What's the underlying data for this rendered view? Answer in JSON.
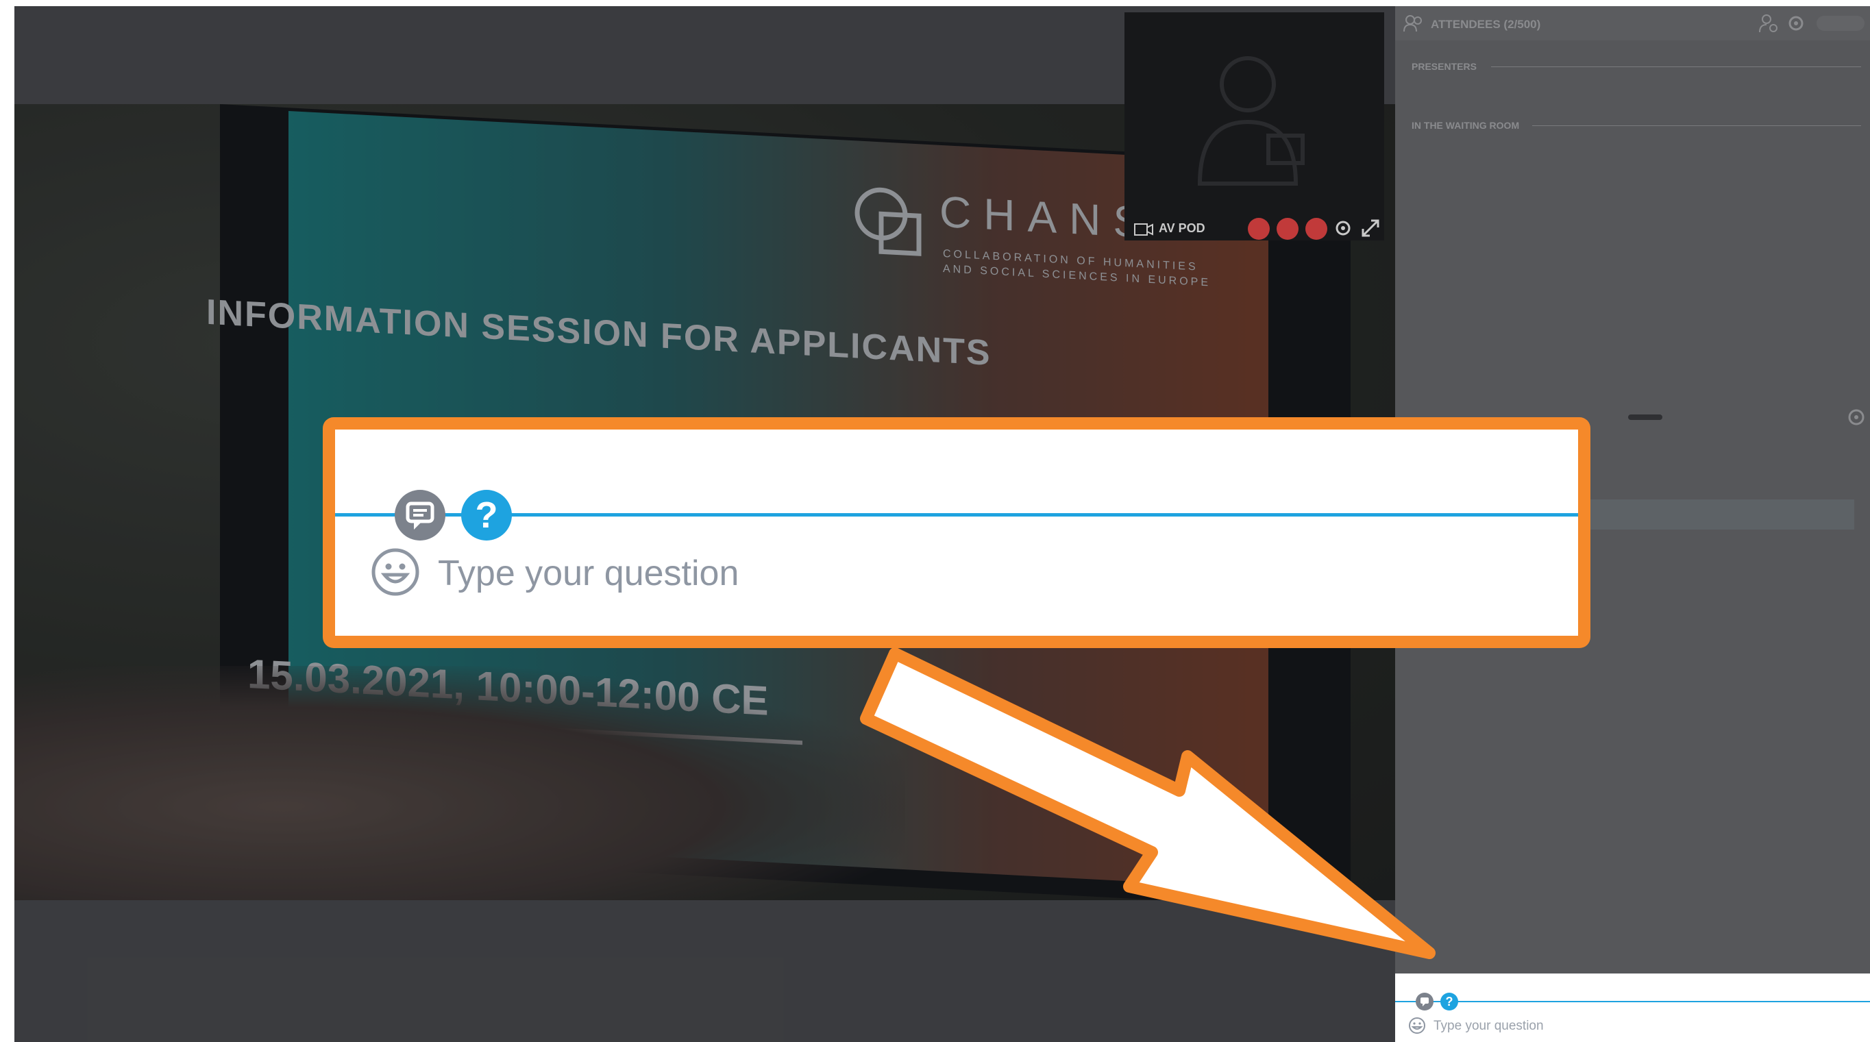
{
  "slide": {
    "logo_text": "CHANSE.",
    "logo_sub1": "COLLABORATION OF HUMANITIES",
    "logo_sub2": "AND SOCIAL SCIENCES IN EUROPE",
    "headline": "INFORMATION SESSION FOR APPLICANTS",
    "date_line": "15.03.2021, 10:00-12:00 CE"
  },
  "av_pod": {
    "label": "AV POD"
  },
  "attendees": {
    "title": "ATTENDEES (2/500)",
    "section_presenters": "PRESENTERS",
    "section_waiting": "IN THE WAITING ROOM"
  },
  "chat": {
    "placeholder": "Type your question"
  },
  "zoom_callout": {
    "placeholder": "Type your question"
  },
  "colors": {
    "callout_border": "#f5892a",
    "accent_blue": "#1ea3e0",
    "dim_gray": "#4a4b4e"
  }
}
